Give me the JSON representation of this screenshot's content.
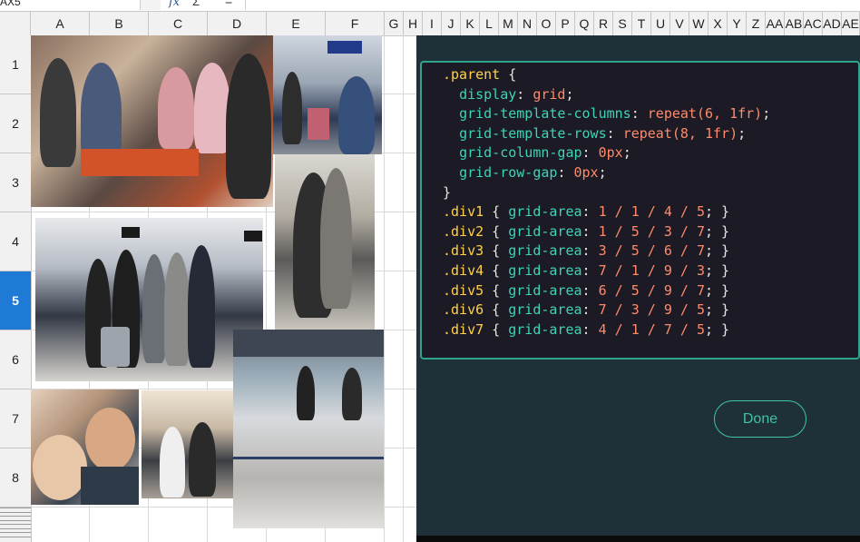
{
  "formula_bar": {
    "name_box": "AX5",
    "fx_icon": "fx",
    "sum_icon": "Σ",
    "equals_icon": "="
  },
  "columns": [
    "A",
    "B",
    "C",
    "D",
    "E",
    "F",
    "G",
    "H",
    "I",
    "J",
    "K",
    "L",
    "M",
    "N",
    "O",
    "P",
    "Q",
    "R",
    "S",
    "T",
    "U",
    "V",
    "W",
    "X",
    "Y",
    "Z",
    "AA",
    "AB",
    "AC",
    "AD",
    "AE"
  ],
  "rows": [
    "1",
    "2",
    "3",
    "4",
    "5",
    "6",
    "7",
    "8"
  ],
  "small_rows": [
    "9",
    "10",
    "11",
    "12",
    "13",
    "14",
    "15",
    "16"
  ],
  "selected_row": "5",
  "code": {
    "lines": [
      ".parent {",
      "  display: grid;",
      "  grid-template-columns: repeat(6, 1fr);",
      "  grid-template-rows: repeat(8, 1fr);",
      "  grid-column-gap: 0px;",
      "  grid-row-gap: 0px;",
      "}",
      ".div1 { grid-area: 1 / 1 / 4 / 5; }",
      ".div2 { grid-area: 1 / 5 / 3 / 7; }",
      ".div3 { grid-area: 3 / 5 / 6 / 7; }",
      ".div4 { grid-area: 7 / 1 / 9 / 3; }",
      ".div5 { grid-area: 6 / 5 / 9 / 7; }",
      ".div6 { grid-area: 7 / 3 / 9 / 5; }",
      ".div7 { grid-area: 4 / 1 / 7 / 5; }"
    ]
  },
  "done_button": {
    "label": "Done"
  },
  "colors": {
    "panel_bg": "#1e3038",
    "code_bg": "#1c1b25",
    "accent": "#3fc4a8",
    "selector": "#ffd24a",
    "property": "#3fd3b7",
    "value": "#ff8a6a",
    "row_select": "#1f7ad6"
  },
  "photos": [
    {
      "name": "photo-group-restaurant"
    },
    {
      "name": "photo-airport-hall"
    },
    {
      "name": "photo-hug"
    },
    {
      "name": "photo-group-airport"
    },
    {
      "name": "photo-selfie"
    },
    {
      "name": "photo-gate-waving"
    },
    {
      "name": "photo-terminal-queue"
    }
  ]
}
